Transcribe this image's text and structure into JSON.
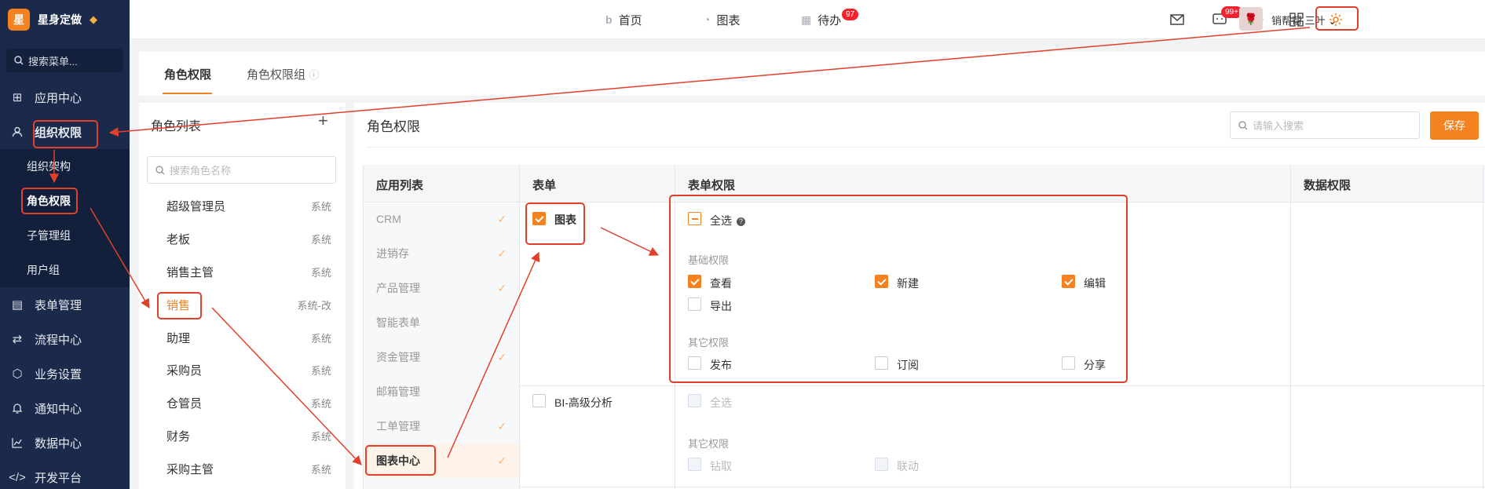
{
  "sidebar": {
    "brand_logo": "星",
    "brand_name": "星身定做",
    "search_placeholder": "搜索菜单...",
    "items": [
      {
        "label": "应用中心",
        "icon": "grid-icon"
      },
      {
        "label": "组织权限",
        "icon": "user-icon"
      },
      {
        "label": "表单管理",
        "icon": "form-icon"
      },
      {
        "label": "流程中心",
        "icon": "flow-icon"
      },
      {
        "label": "业务设置",
        "icon": "cube-icon"
      },
      {
        "label": "通知中心",
        "icon": "bell-icon"
      },
      {
        "label": "数据中心",
        "icon": "chart-icon"
      },
      {
        "label": "开发平台",
        "icon": "code-icon"
      }
    ],
    "sub_items": [
      "组织架构",
      "角色权限",
      "子管理组",
      "用户组"
    ]
  },
  "topbar": {
    "nav": [
      {
        "label": "首页",
        "icon": "b-icon"
      },
      {
        "label": "图表",
        "icon": "pie-icon"
      },
      {
        "label": "待办",
        "icon": "calendar-icon",
        "badge": "97"
      }
    ],
    "message_badge": "99+",
    "user_name": "销帮帮 三叶"
  },
  "tabs": [
    "角色权限",
    "角色权限组"
  ],
  "role_panel": {
    "title": "角色列表",
    "search_placeholder": "搜索角色名称",
    "roles": [
      {
        "name": "超级管理员",
        "tag": "系统"
      },
      {
        "name": "老板",
        "tag": "系统"
      },
      {
        "name": "销售主管",
        "tag": "系统"
      },
      {
        "name": "销售",
        "tag": "系统-改"
      },
      {
        "name": "助理",
        "tag": "系统"
      },
      {
        "name": "采购员",
        "tag": "系统"
      },
      {
        "name": "仓管员",
        "tag": "系统"
      },
      {
        "name": "财务",
        "tag": "系统"
      },
      {
        "name": "采购主管",
        "tag": "系统"
      }
    ]
  },
  "main_panel": {
    "title": "角色权限",
    "search_placeholder": "请输入搜索",
    "save_label": "保存",
    "headers": [
      "应用列表",
      "表单",
      "表单权限",
      "数据权限"
    ],
    "apps": [
      "CRM",
      "进销存",
      "产品管理",
      "智能表单",
      "资金管理",
      "邮箱管理",
      "工单管理",
      "图表中心"
    ],
    "forms": [
      {
        "name": "图表",
        "select_all": "全选",
        "basic_title": "基础权限",
        "basic": [
          "查看",
          "新建",
          "编辑",
          "导出"
        ],
        "other_title": "其它权限",
        "other": [
          "发布",
          "订阅",
          "分享"
        ]
      },
      {
        "name": "BI-高级分析",
        "select_all": "全选",
        "other_title": "其它权限",
        "other": [
          "钻取",
          "联动"
        ]
      }
    ]
  },
  "colors": {
    "accent": "#f58220",
    "sidebar_bg": "#1b2a4b",
    "annotation": "#e2402b"
  }
}
